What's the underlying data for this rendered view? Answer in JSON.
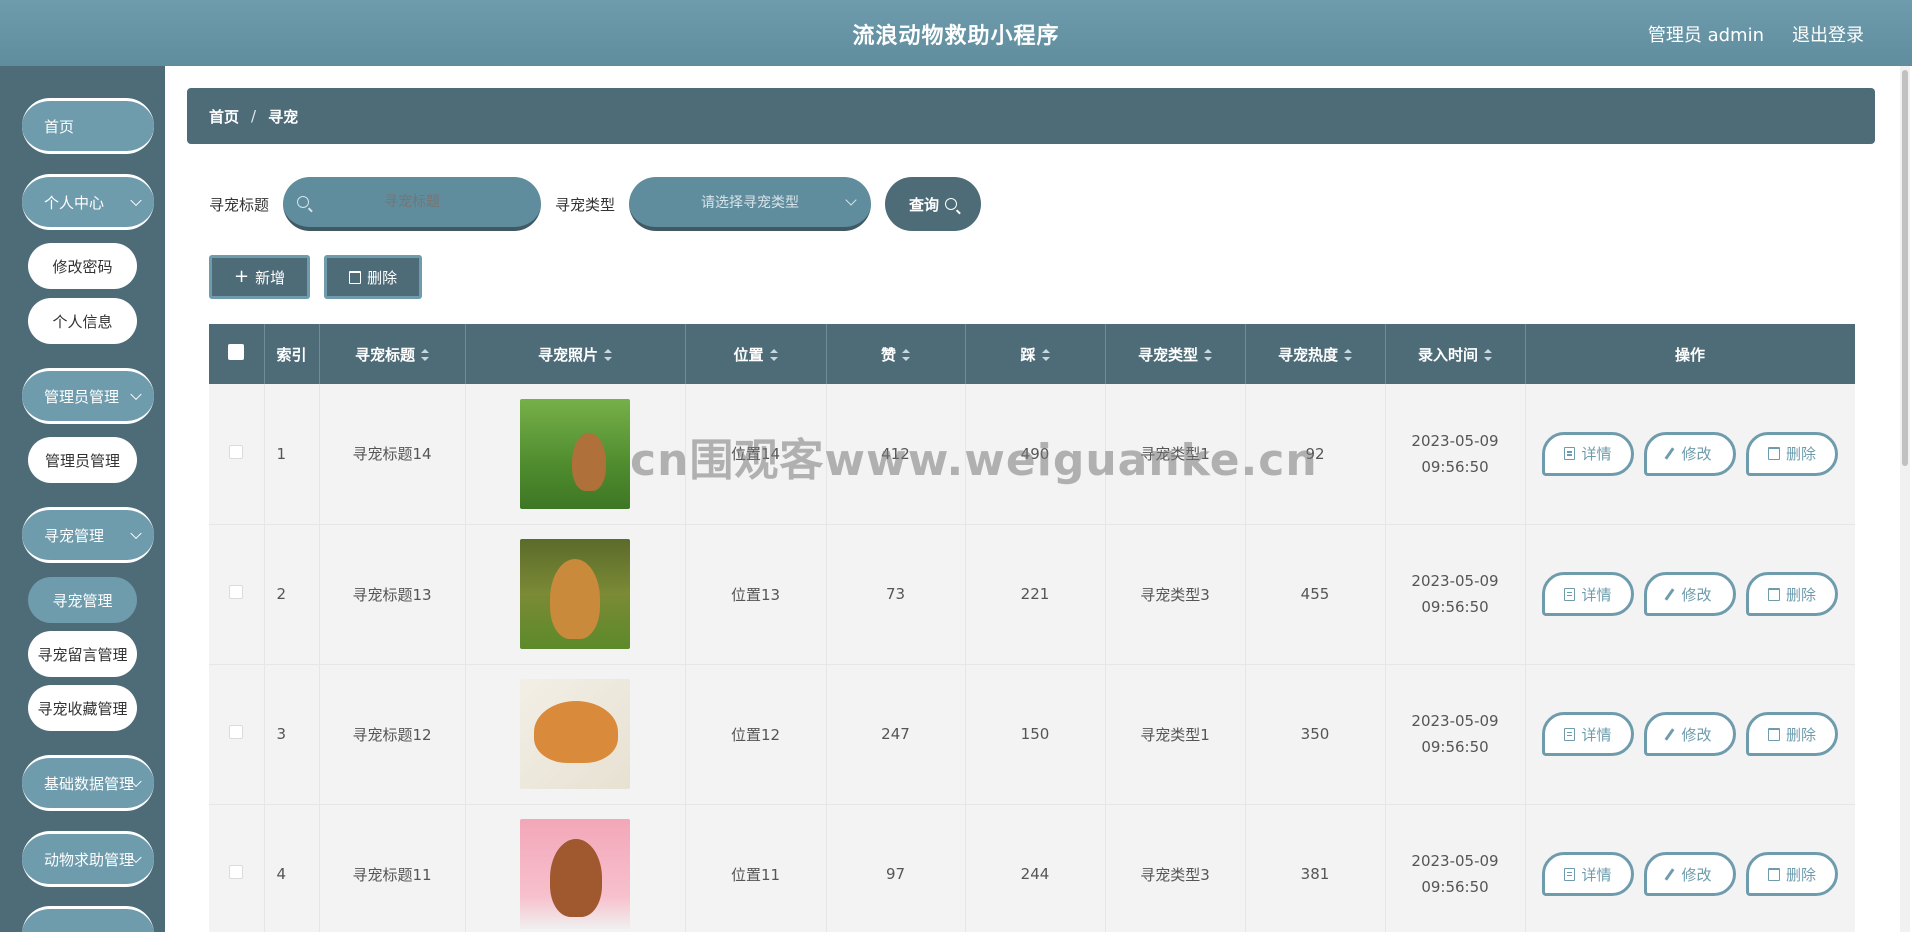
{
  "header": {
    "title": "流浪动物救助小程序",
    "user": "管理员 admin",
    "logout": "退出登录"
  },
  "sidebar": {
    "home": "首页",
    "personal": "个人中心",
    "change_password": "修改密码",
    "personal_info": "个人信息",
    "admin_group": "管理员管理",
    "admin_item": "管理员管理",
    "pet_group": "寻宠管理",
    "pet_item": "寻宠管理",
    "pet_comment": "寻宠留言管理",
    "pet_collect": "寻宠收藏管理",
    "base_data": "基础数据管理",
    "animal_help": "动物求助管理"
  },
  "breadcrumb": {
    "home": "首页",
    "sep": "/",
    "current": "寻宠"
  },
  "search": {
    "title_label": "寻宠标题",
    "title_placeholder": "寻宠标题",
    "type_label": "寻宠类型",
    "type_placeholder": "请选择寻宠类型",
    "query_label": "查询"
  },
  "actions": {
    "add": "新增",
    "delete": "删除"
  },
  "table": {
    "columns": [
      "索引",
      "寻宠标题",
      "寻宠照片",
      "位置",
      "赞",
      "踩",
      "寻宠类型",
      "寻宠热度",
      "录入时间",
      "操作"
    ],
    "op_detail": "详情",
    "op_edit": "修改",
    "op_delete": "删除",
    "rows": [
      {
        "index": "1",
        "title": "寻宠标题14",
        "location": "位置14",
        "like": "412",
        "dislike": "490",
        "type": "寻宠类型1",
        "heat": "92",
        "time": "2023-05-09 09:56:50"
      },
      {
        "index": "2",
        "title": "寻宠标题13",
        "location": "位置13",
        "like": "73",
        "dislike": "221",
        "type": "寻宠类型3",
        "heat": "455",
        "time": "2023-05-09 09:56:50"
      },
      {
        "index": "3",
        "title": "寻宠标题12",
        "location": "位置12",
        "like": "247",
        "dislike": "150",
        "type": "寻宠类型1",
        "heat": "350",
        "time": "2023-05-09 09:56:50"
      },
      {
        "index": "4",
        "title": "寻宠标题11",
        "location": "位置11",
        "like": "97",
        "dislike": "244",
        "type": "寻宠类型3",
        "heat": "381",
        "time": "2023-05-09 09:56:50"
      }
    ]
  },
  "watermark": "cn围观客www.weiguanke.cn"
}
